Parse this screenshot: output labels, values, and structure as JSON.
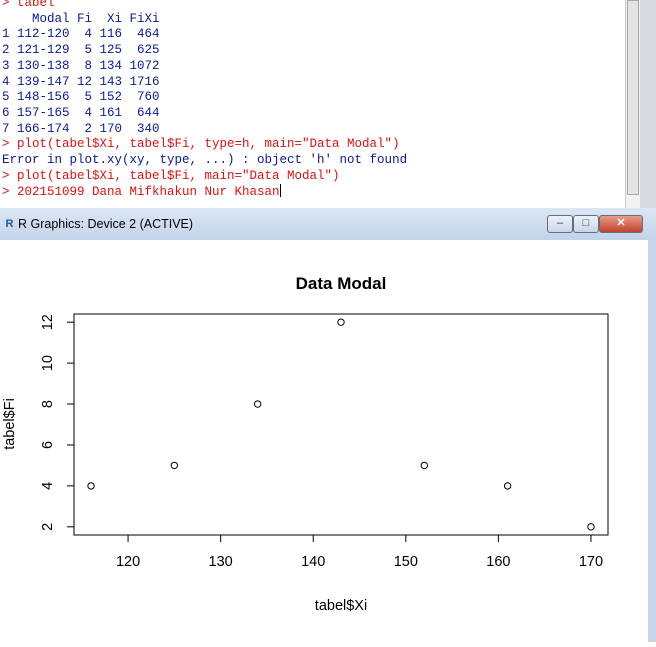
{
  "console": {
    "lines": [
      {
        "text": "> tabel",
        "style": "red"
      },
      {
        "text": "    Modal Fi  Xi FiXi",
        "style": "blue"
      },
      {
        "text": "1 112-120  4 116  464",
        "style": "blue"
      },
      {
        "text": "2 121-129  5 125  625",
        "style": "blue"
      },
      {
        "text": "3 130-138  8 134 1072",
        "style": "blue"
      },
      {
        "text": "4 139-147 12 143 1716",
        "style": "blue"
      },
      {
        "text": "5 148-156  5 152  760",
        "style": "blue"
      },
      {
        "text": "6 157-165  4 161  644",
        "style": "blue"
      },
      {
        "text": "7 166-174  2 170  340",
        "style": "blue"
      },
      {
        "text": "> plot(tabel$Xi, tabel$Fi, type=h, main=\"Data Modal\")",
        "style": "red"
      },
      {
        "text": "Error in plot.xy(xy, type, ...) : object 'h' not found",
        "style": "blue"
      },
      {
        "text": "> plot(tabel$Xi, tabel$Fi, main=\"Data Modal\")",
        "style": "red"
      },
      {
        "text": "> 202151099 Dana Mifkhakun Nur Khasan",
        "style": "red"
      }
    ]
  },
  "graphics_window": {
    "title": "R Graphics: Device 2 (ACTIVE)",
    "logo": "R",
    "buttons": {
      "minimize": "–",
      "maximize": "□",
      "close": "✕"
    }
  },
  "chart_data": {
    "type": "scatter",
    "title": "Data Modal",
    "xlabel": "tabel$Xi",
    "ylabel": "tabel$Fi",
    "x": [
      116,
      125,
      134,
      143,
      152,
      161,
      170
    ],
    "y": [
      4,
      5,
      8,
      12,
      5,
      4,
      2
    ],
    "xlim": [
      114.16,
      171.84
    ],
    "ylim": [
      1.6,
      12.4
    ],
    "xticks": [
      120,
      130,
      140,
      150,
      160,
      170
    ],
    "yticks": [
      2,
      4,
      6,
      8,
      10,
      12
    ],
    "marker": "open-circle",
    "grid": false
  }
}
